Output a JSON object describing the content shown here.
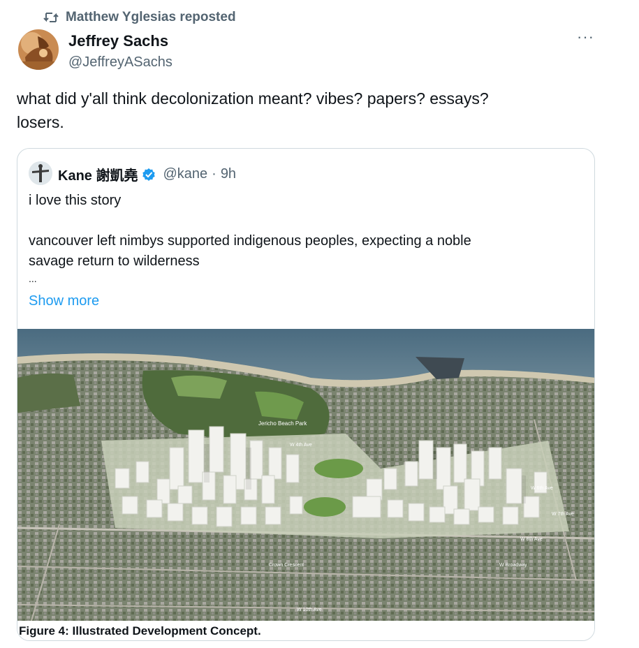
{
  "repost": {
    "icon": "repost-icon",
    "label": "Matthew Yglesias reposted"
  },
  "author": {
    "name": "Jeffrey Sachs",
    "handle": "@JeffreyASachs",
    "avatar_icon": "avatar"
  },
  "more_label": "···",
  "tweet": {
    "line1": "what did y'all think decolonization meant? vibes? papers? essays?",
    "line2": "losers."
  },
  "quote": {
    "name": "Kane 謝凱堯",
    "verified_icon": "verified-badge-icon",
    "handle": "@kane",
    "dot": "·",
    "time": "9h",
    "lines": [
      "i love this story",
      "vancouver left nimbys supported indigenous peoples, expecting a noble",
      "savage return to wilderness",
      "..."
    ],
    "show_more": "Show more",
    "image": {
      "park_label": "Jericho Beach Park",
      "street_labels": [
        "W 4th Ave",
        "W 6th Ave",
        "W 7th Ave",
        "W 8th Ave",
        "W Broadway",
        "Crown Crescent",
        "W 10th Ave"
      ]
    },
    "caption": "Figure 4: Illustrated Development Concept."
  },
  "colors": {
    "link": "#1d9bf0",
    "secondary_text": "#536471",
    "border": "#cfd9de"
  }
}
